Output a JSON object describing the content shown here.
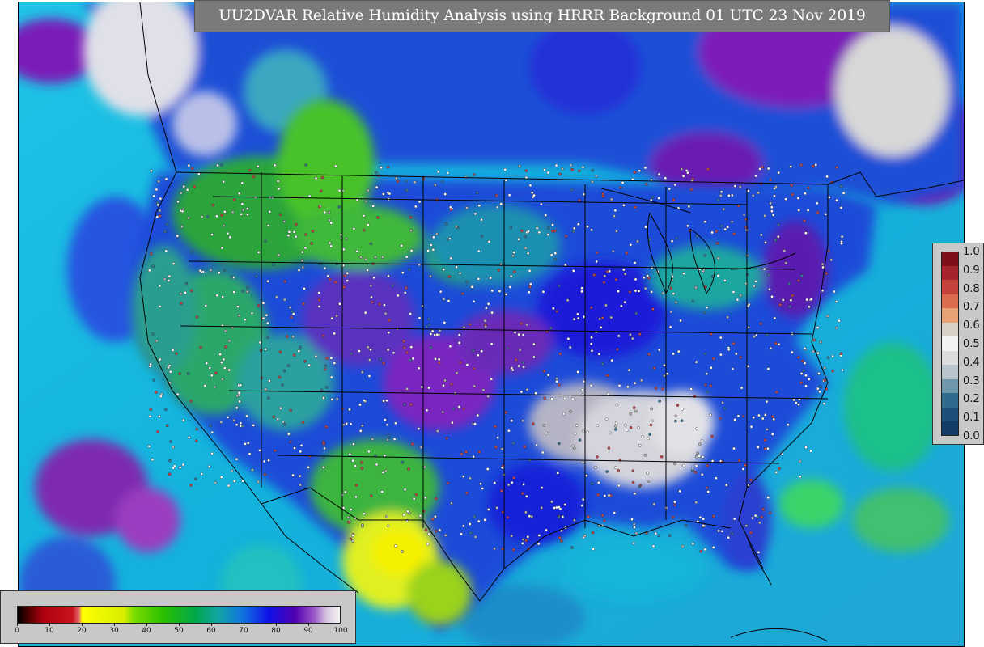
{
  "title": "UU2DVAR Relative Humidity Analysis using HRRR Background 01 UTC 23 Nov 2019",
  "increment_legend": {
    "labels": [
      "1.0",
      "0.9",
      "0.8",
      "0.7",
      "0.6",
      "0.5",
      "0.4",
      "0.3",
      "0.2",
      "0.1",
      "0.0"
    ],
    "colors": [
      "#7d0e1a",
      "#a3242c",
      "#c4433a",
      "#db6b4f",
      "#e9a178",
      "#d9d1c8",
      "#f2f2f2",
      "#dcdcdc",
      "#b7c4cc",
      "#6e97ab",
      "#2f6a8c",
      "#1d4f79",
      "#123c66"
    ]
  },
  "rh_legend": {
    "ticks": [
      "0",
      "10",
      "20",
      "30",
      "40",
      "50",
      "60",
      "70",
      "80",
      "90",
      "100"
    ],
    "stops": [
      {
        "v": 0,
        "c": "#000000"
      },
      {
        "v": 4,
        "c": "#5a0000"
      },
      {
        "v": 8,
        "c": "#b00010"
      },
      {
        "v": 17,
        "c": "#c8141c"
      },
      {
        "v": 19,
        "c": "#e06a6a"
      },
      {
        "v": 20,
        "c": "#ffff00"
      },
      {
        "v": 33,
        "c": "#d8ee00"
      },
      {
        "v": 36,
        "c": "#7ddc00"
      },
      {
        "v": 45,
        "c": "#2cc000"
      },
      {
        "v": 55,
        "c": "#00a84a"
      },
      {
        "v": 62,
        "c": "#12a6a2"
      },
      {
        "v": 70,
        "c": "#0f72e0"
      },
      {
        "v": 78,
        "c": "#1010e8"
      },
      {
        "v": 86,
        "c": "#5000b0"
      },
      {
        "v": 92,
        "c": "#9a58c8"
      },
      {
        "v": 96,
        "c": "#d9c8e0"
      },
      {
        "v": 100,
        "c": "#f4f4f4"
      }
    ]
  },
  "map": {
    "ocean_color": "#14b9e0",
    "land_color": "#1b54d2",
    "boundary_color": "#000000",
    "station_color": "#ffffff"
  }
}
